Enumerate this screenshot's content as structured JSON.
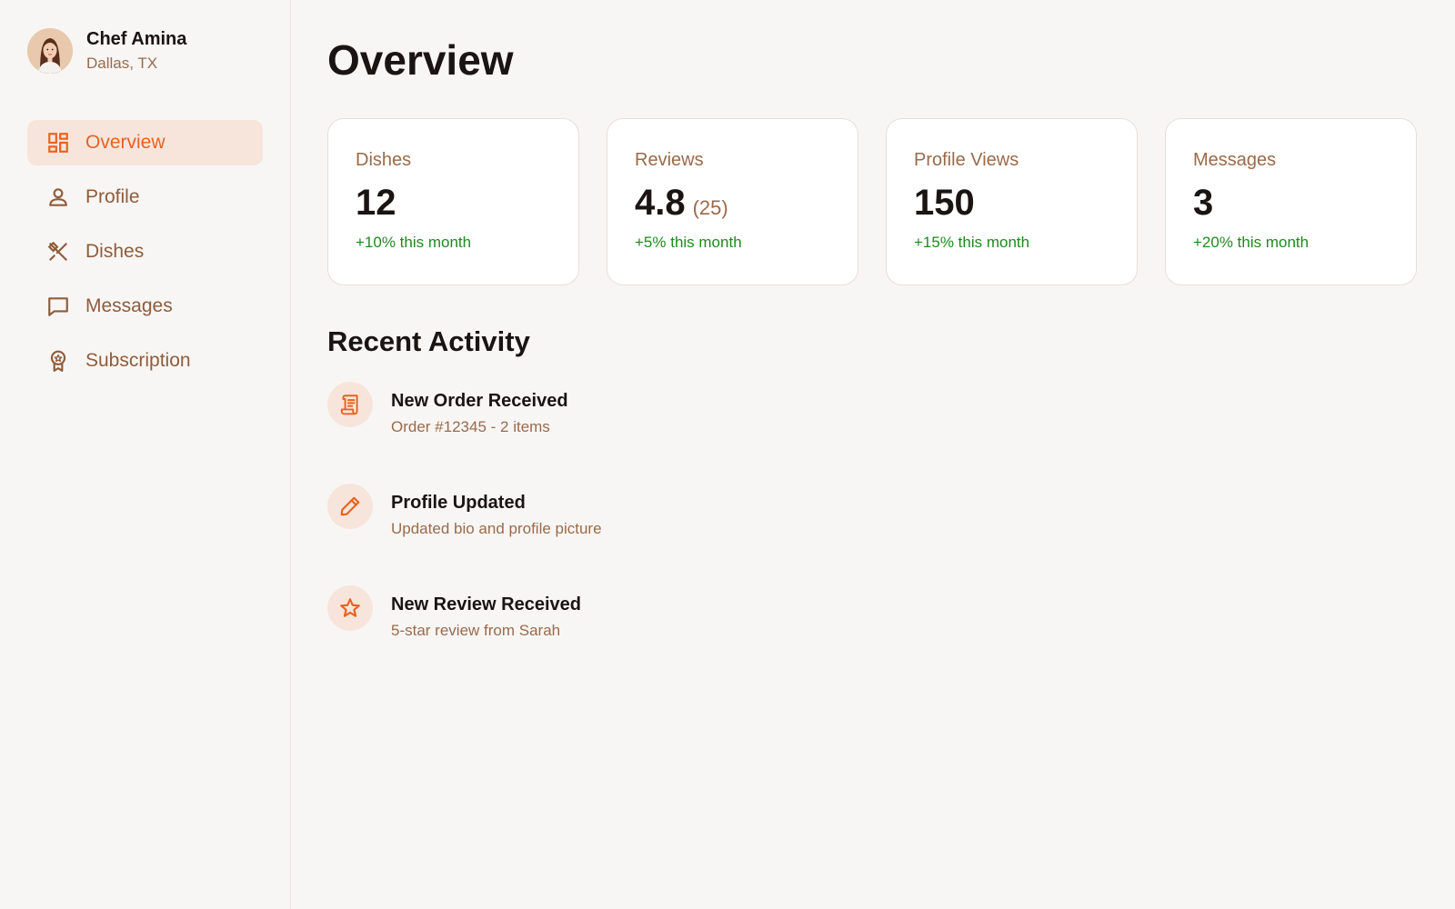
{
  "user": {
    "name": "Chef Amina",
    "location": "Dallas, TX",
    "avatar_icon": "chef-avatar"
  },
  "nav": {
    "items": [
      {
        "label": "Overview",
        "icon": "dashboard-icon",
        "active": true
      },
      {
        "label": "Profile",
        "icon": "person-icon",
        "active": false
      },
      {
        "label": "Dishes",
        "icon": "utensils-icon",
        "active": false
      },
      {
        "label": "Messages",
        "icon": "chat-icon",
        "active": false
      },
      {
        "label": "Subscription",
        "icon": "badge-icon",
        "active": false
      }
    ]
  },
  "page": {
    "title": "Overview"
  },
  "stats": [
    {
      "label": "Dishes",
      "value": "12",
      "sub": "",
      "change": "+10% this month"
    },
    {
      "label": "Reviews",
      "value": "4.8",
      "sub": "(25)",
      "change": "+5% this month"
    },
    {
      "label": "Profile Views",
      "value": "150",
      "sub": "",
      "change": "+15% this month"
    },
    {
      "label": "Messages",
      "value": "3",
      "sub": "",
      "change": "+20% this month"
    }
  ],
  "recent_activity": {
    "title": "Recent Activity",
    "items": [
      {
        "title": "New Order Received",
        "description": "Order #12345 - 2 items",
        "icon": "receipt-icon"
      },
      {
        "title": "Profile Updated",
        "description": "Updated bio and profile picture",
        "icon": "pencil-icon"
      },
      {
        "title": "New Review Received",
        "description": "5-star review from Sarah",
        "icon": "star-icon"
      }
    ]
  },
  "colors": {
    "accent": "#e8621f",
    "accent_bg": "#f7e5dc",
    "muted_text": "#9a6a4a",
    "positive": "#1e8a1e",
    "background": "#f8f6f4"
  }
}
